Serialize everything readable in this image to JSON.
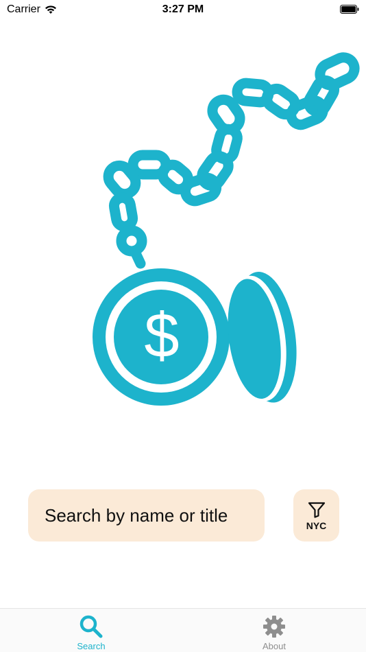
{
  "status_bar": {
    "carrier": "Carrier",
    "time": "3:27 PM",
    "icons": [
      "wifi-icon",
      "battery-icon"
    ]
  },
  "hero": {
    "illustration": "ball-and-chain-money-icon",
    "symbol": "$"
  },
  "search": {
    "placeholder": "Search by name or title",
    "value": ""
  },
  "filter": {
    "icon": "filter-funnel-icon",
    "label": "NYC"
  },
  "tab_bar": {
    "tabs": [
      {
        "label": "Search",
        "icon": "magnifier-icon",
        "selected": true
      },
      {
        "label": "About",
        "icon": "gear-icon",
        "selected": false
      }
    ]
  },
  "colors": {
    "accent": "#1db3cc",
    "field_background": "#fbead7",
    "inactive_tab": "#8e8e8e"
  }
}
